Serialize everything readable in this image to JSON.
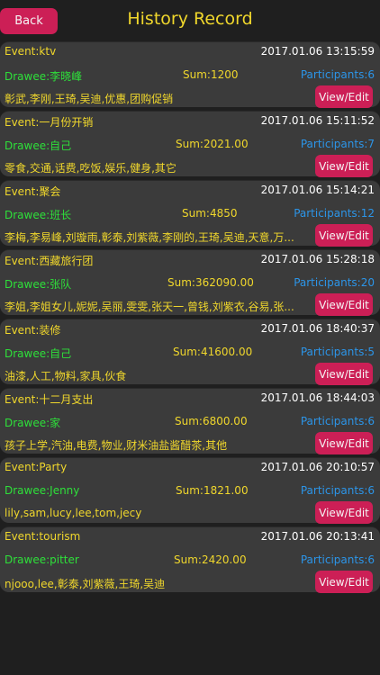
{
  "header": {
    "back_label": "Back",
    "title": "History Record"
  },
  "records": [
    {
      "event": "Event:ktv",
      "date": "2017.01.06 13:15:59",
      "drawee": "Drawee:李晓峰",
      "sum": "Sum:1200",
      "participants": "Participants:6",
      "people": "彰武,李刚,王琦,吴迪,优惠,团购促销",
      "button": "View/Edit"
    },
    {
      "event": "Event:一月份开销",
      "date": "2017.01.06 15:11:52",
      "drawee": "Drawee:自己",
      "sum": "Sum:2021.00",
      "participants": "Participants:7",
      "people": "零食,交通,话费,吃饭,娱乐,健身,其它",
      "button": "View/Edit"
    },
    {
      "event": "Event:聚会",
      "date": "2017.01.06 15:14:21",
      "drawee": "Drawee:班长",
      "sum": "Sum:4850",
      "participants": "Participants:12",
      "people": "李梅,李易峰,刘璇雨,彰泰,刘紫薇,李刚的,王琦,吴迪,天意,万...",
      "button": "View/Edit"
    },
    {
      "event": "Event:西藏旅行团",
      "date": "2017.01.06 15:28:18",
      "drawee": "Drawee:张队",
      "sum": "Sum:362090.00",
      "participants": "Participants:20",
      "people": "李姐,李姐女儿,妮妮,吴丽,雯雯,张天一,曾钱,刘紫衣,谷易,张...",
      "button": "View/Edit"
    },
    {
      "event": "Event:装修",
      "date": "2017.01.06 18:40:37",
      "drawee": "Drawee:自己",
      "sum": "Sum:41600.00",
      "participants": "Participants:5",
      "people": "油漆,人工,物料,家具,伙食",
      "button": "View/Edit"
    },
    {
      "event": "Event:十二月支出",
      "date": "2017.01.06 18:44:03",
      "drawee": "Drawee:家",
      "sum": "Sum:6800.00",
      "participants": "Participants:6",
      "people": "孩子上学,汽油,电费,物业,财米油盐酱醋茶,其他",
      "button": "View/Edit"
    },
    {
      "event": "Event:Party",
      "date": "2017.01.06 20:10:57",
      "drawee": "Drawee:Jenny",
      "sum": "Sum:1821.00",
      "participants": "Participants:6",
      "people": "lily,sam,lucy,lee,tom,jecy",
      "button": "View/Edit"
    },
    {
      "event": "Event:tourism",
      "date": "2017.01.06 20:13:41",
      "drawee": "Drawee:pitter",
      "sum": "Sum:2420.00",
      "participants": "Participants:6",
      "people": "njooo,lee,彰泰,刘紫薇,王琦,吴迪",
      "button": "View/Edit"
    }
  ]
}
